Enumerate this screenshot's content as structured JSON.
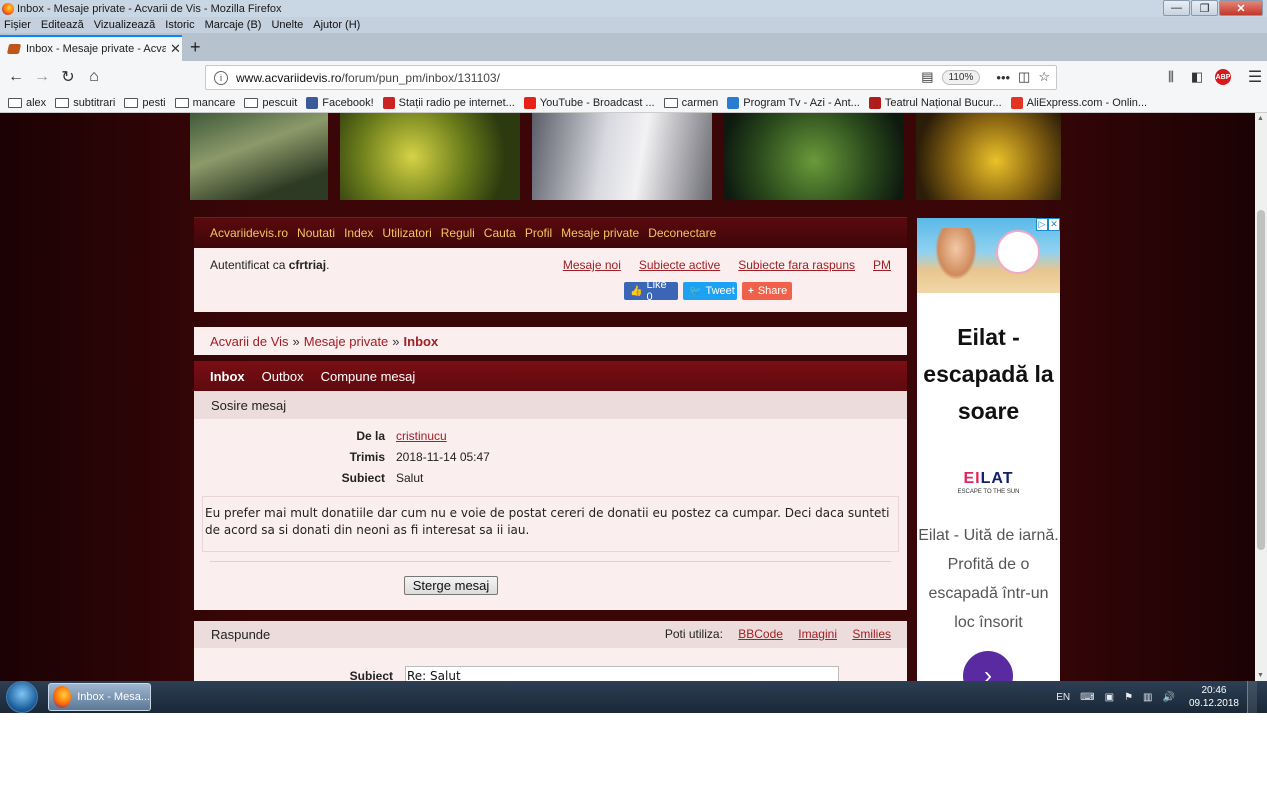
{
  "window": {
    "title": "Inbox - Mesaje private - Acvarii de Vis - Mozilla Firefox",
    "minimize": "—",
    "maximize": "❐",
    "close": "✕"
  },
  "menubar": [
    "Fișier",
    "Editează",
    "Vizualizează",
    "Istoric",
    "Marcaje (B)",
    "Unelte",
    "Ajutor (H)"
  ],
  "tab": {
    "label": "Inbox - Mesaje private - Acvarii",
    "close": "✕",
    "new_tab": "+"
  },
  "nav": {
    "back": "←",
    "forward": "→",
    "reload": "↻",
    "home": "⌂",
    "url_host": "www.acvariidevis.ro",
    "url_path": "/forum/pun_pm/inbox/131103/",
    "zoom": "110%",
    "more": "•••",
    "abp": "ABP",
    "menu": "☰"
  },
  "bookmarks": [
    {
      "label": "alex",
      "kind": "folder"
    },
    {
      "label": "subtitrari",
      "kind": "folder"
    },
    {
      "label": "pesti",
      "kind": "folder"
    },
    {
      "label": "mancare",
      "kind": "folder"
    },
    {
      "label": "pescuit",
      "kind": "folder"
    },
    {
      "label": "Facebook!",
      "kind": "site",
      "color": "#3b5998"
    },
    {
      "label": "Stații radio pe internet...",
      "kind": "site",
      "color": "#cc2222"
    },
    {
      "label": "YouTube - Broadcast ...",
      "kind": "site",
      "color": "#e62117"
    },
    {
      "label": "carmen",
      "kind": "folder"
    },
    {
      "label": "Program Tv - Azi - Ant...",
      "kind": "site",
      "color": "#2b7bd1"
    },
    {
      "label": "Teatrul Național Bucur...",
      "kind": "site",
      "color": "#b01c1c"
    },
    {
      "label": "AliExpress.com - Onlin...",
      "kind": "site",
      "color": "#e43225"
    }
  ],
  "forum": {
    "navlinks": [
      "Acvariidevis.ro",
      "Noutati",
      "Index",
      "Utilizatori",
      "Reguli",
      "Cauta",
      "Profil",
      "Mesaje private",
      "Deconectare"
    ],
    "auth_prefix": "Autentificat ca ",
    "username": "cfrtriaj",
    "auth_suffix": ".",
    "user_links": [
      "Mesaje noi",
      "Subiecte active",
      "Subiecte fara raspuns",
      "PM"
    ],
    "social": {
      "like": "Like 0",
      "tweet": "Tweet",
      "share": "Share"
    },
    "breadcrumb": {
      "home": "Acvarii de Vis",
      "sep": "»",
      "pm": "Mesaje private",
      "current": "Inbox"
    },
    "pm_tabs": [
      "Inbox",
      "Outbox",
      "Compune mesaj"
    ],
    "message": {
      "header": "Sosire mesaj",
      "from_label": "De la",
      "from_value": "cristinucu",
      "sent_label": "Trimis",
      "sent_value": "2018-11-14 05:47",
      "subject_label": "Subiect",
      "subject_value": "Salut",
      "body": "Eu prefer mai mult donatiile dar cum nu e voie de postat cereri de donatii eu postez ca cumpar. Deci daca sunteti de acord sa si donati din neoni as fi interesat sa ii iau.",
      "delete_button": "Sterge mesaj"
    },
    "reply": {
      "header": "Raspunde",
      "tools_label": "Poti utiliza:",
      "tools": [
        "BBCode",
        "Imagini",
        "Smilies"
      ],
      "subject_label": "Subiect",
      "subject_value": "Re: Salut"
    }
  },
  "ad": {
    "title": "Eilat - escapadă la soare",
    "logo_e": "EI",
    "logo_rest": "LAT",
    "logo_sub": "ESCAPE TO THE SUN",
    "text": "Eilat - Uită de iarnă. Profită de o escapadă într-un loc însorit",
    "go": "›"
  },
  "taskbar": {
    "task_label": "Inbox - Mesa...",
    "lang": "EN",
    "time": "20:46",
    "date": "09.12.2018"
  },
  "colors": {
    "page_bg": "#3a0608",
    "nav_link": "#f3c560",
    "link": "#a02025",
    "panel": "#fbeeee"
  }
}
